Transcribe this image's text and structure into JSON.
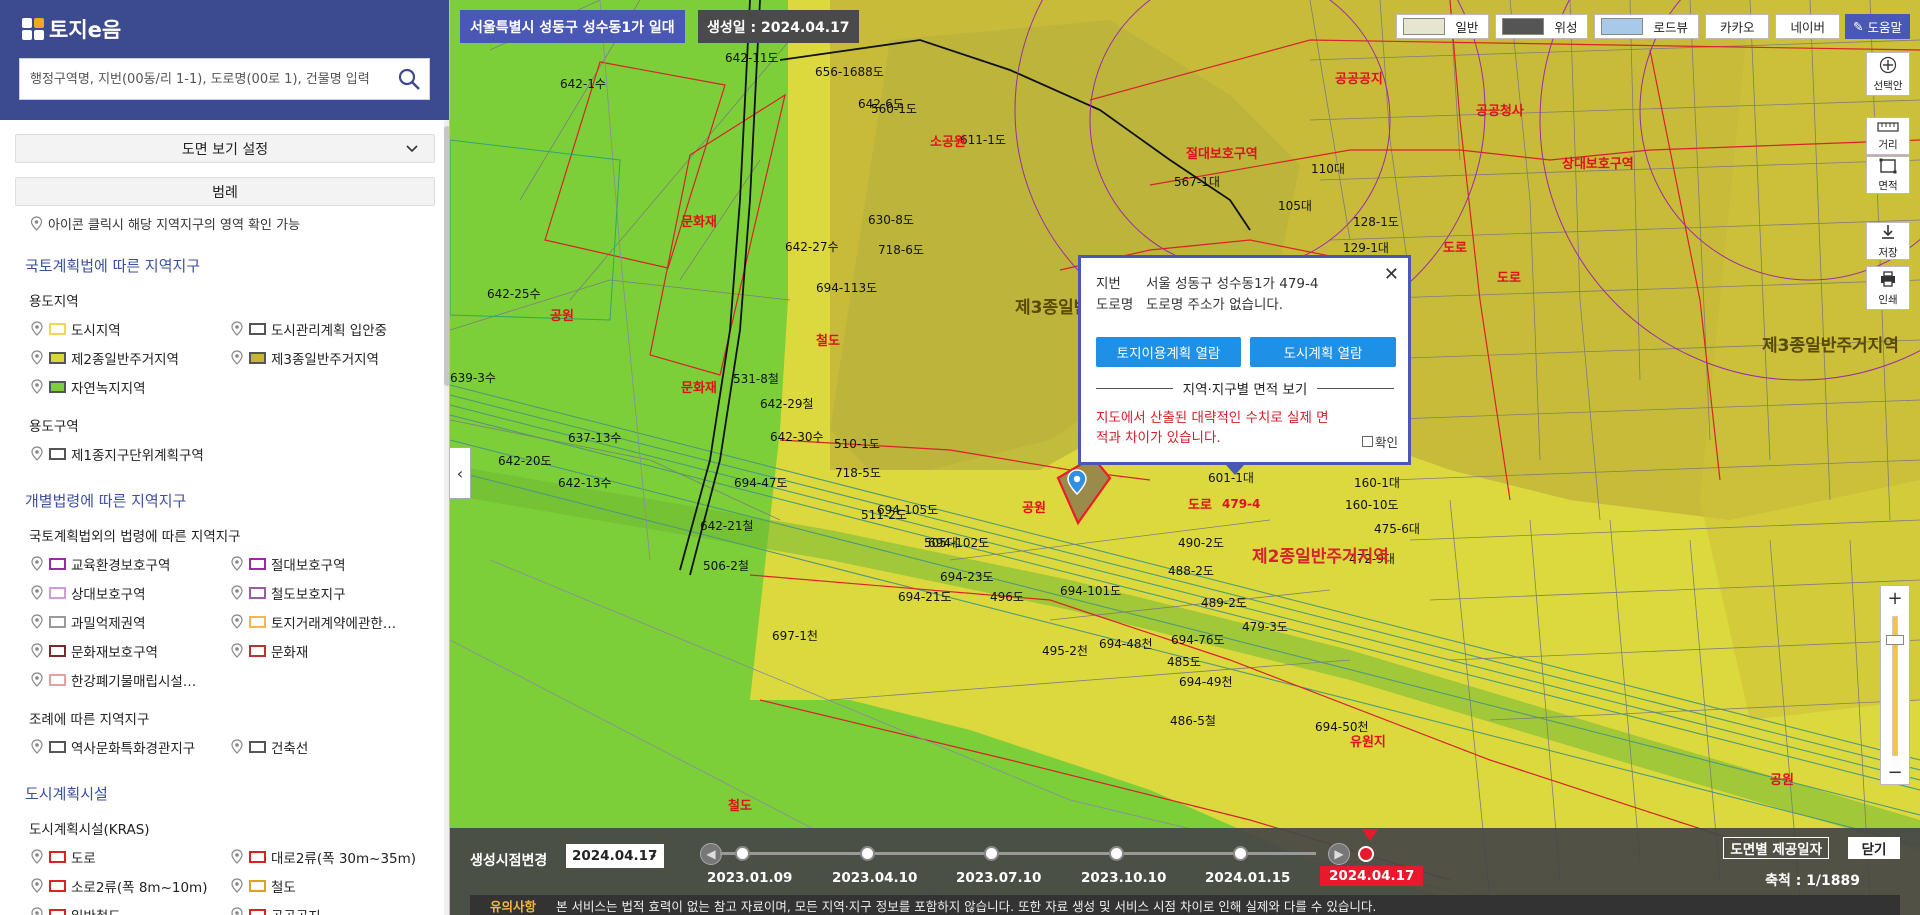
{
  "app": {
    "title": "토지e음"
  },
  "search": {
    "placeholder": "행정구역명, 지번(00동/리 1-1), 도로명(00로 1), 건물명 입력"
  },
  "sidebar": {
    "view_settings": "도면 보기 설정",
    "legend": "범례",
    "hint": "아이콘 클릭시 해당 지역지구의 영역 확인 가능",
    "sections": [
      {
        "title": "국토계획법에 따른 지역지구",
        "groups": [
          {
            "title": "용도지역",
            "items": [
              {
                "label": "도시지역",
                "color": "#f2d64b",
                "fill": "#ffffff"
              },
              {
                "label": "도시관리계획 입안중",
                "color": "#555555",
                "fill": "#ffffff"
              },
              {
                "label": "제2종일반주거지역",
                "color": "#555555",
                "fill": "#d8d83a"
              },
              {
                "label": "제3종일반주거지역",
                "color": "#555555",
                "fill": "#c4b534"
              },
              {
                "label": "자연녹지지역",
                "color": "#555555",
                "fill": "#7bd03a"
              }
            ]
          },
          {
            "title": "용도구역",
            "items": [
              {
                "label": "제1종지구단위계획구역",
                "color": "#555555",
                "fill": "#ffffff"
              }
            ]
          }
        ]
      },
      {
        "title": "개별법령에 따른 지역지구",
        "groups": [
          {
            "title": "국토계획법외의 법령에 따른 지역지구",
            "items": [
              {
                "label": "교육환경보호구역",
                "color": "#9c2aa8",
                "fill": "#ffffff"
              },
              {
                "label": "절대보호구역",
                "color": "#9c2aa8",
                "fill": "#ffffff"
              },
              {
                "label": "상대보호구역",
                "color": "#d39ad7",
                "fill": "#ffffff"
              },
              {
                "label": "철도보호지구",
                "color": "#9c5aa8",
                "fill": "#ffffff"
              },
              {
                "label": "과밀억제권역",
                "color": "#999999",
                "fill": "#ffffff"
              },
              {
                "label": "토지거래계약에관한…",
                "color": "#f2b84b",
                "fill": "#ffffff"
              },
              {
                "label": "문화재보호구역",
                "color": "#7a2a2a",
                "fill": "#ffffff"
              },
              {
                "label": "문화재",
                "color": "#c03030",
                "fill": "#ffffff"
              },
              {
                "label": "한강폐기물매립시설…",
                "color": "#e8a0a0",
                "fill": "#ffffff"
              }
            ]
          },
          {
            "title": "조례에 따른 지역지구",
            "items": [
              {
                "label": "역사문화특화경관지구",
                "color": "#555555",
                "fill": "#ffffff"
              },
              {
                "label": "건축선",
                "color": "#555555",
                "fill": "#ffffff"
              }
            ]
          }
        ]
      },
      {
        "title": "도시계획시설",
        "groups": [
          {
            "title": "도시계획시설(KRAS)",
            "items": [
              {
                "label": "도로",
                "color": "#e02020",
                "fill": "#ffffff"
              },
              {
                "label": "대로2류(폭 30m~35m)",
                "color": "#e02020",
                "fill": "#ffffff"
              },
              {
                "label": "소로2류(폭 8m~10m)",
                "color": "#e02020",
                "fill": "#ffffff"
              },
              {
                "label": "철도",
                "color": "#e0a020",
                "fill": "#ffffff"
              },
              {
                "label": "일반철도",
                "color": "#e02020",
                "fill": "#ffffff"
              },
              {
                "label": "공공공지",
                "color": "#e02020",
                "fill": "#ffffff"
              }
            ]
          }
        ]
      }
    ]
  },
  "map": {
    "address": "서울특별시 성동구 성수동1가 일대",
    "created_date": "생성일 : 2024.04.17",
    "map_types": [
      "일반",
      "위성",
      "로드뷰",
      "카카오",
      "네이버"
    ],
    "help": "도움말",
    "tools": [
      {
        "label": "선택안",
        "icon": "plus-circle-icon"
      },
      {
        "label": "거리",
        "icon": "ruler-icon"
      },
      {
        "label": "면적",
        "icon": "area-icon"
      },
      {
        "label": "저장",
        "icon": "download-icon"
      },
      {
        "label": "인쇄",
        "icon": "print-icon"
      }
    ],
    "labels_black": [
      [
        "642-1수",
        0,
        0
      ],
      [
        "642-11도",
        0,
        0
      ],
      [
        "656-1688도",
        0,
        0
      ],
      [
        "560-1도",
        0,
        0
      ],
      [
        "611-1도",
        0,
        0
      ],
      [
        "642-6도",
        0,
        0
      ],
      [
        "642-27수",
        0,
        0
      ],
      [
        "630-8도",
        0,
        0
      ],
      [
        "718-6도",
        0,
        0
      ],
      [
        "694-113도",
        0,
        0
      ],
      [
        "642-25수",
        0,
        0
      ],
      [
        "639-3수",
        0,
        0
      ],
      [
        "531-8철",
        0,
        0
      ],
      [
        "642-29철",
        0,
        0
      ],
      [
        "637-13수",
        0,
        0
      ],
      [
        "642-30수",
        0,
        0
      ],
      [
        "510-1도",
        0,
        0
      ],
      [
        "642-20도",
        0,
        0
      ],
      [
        "642-13수",
        0,
        0
      ],
      [
        "694-47도",
        0,
        0
      ],
      [
        "718-5도",
        0,
        0
      ],
      [
        "511-2도",
        0,
        0
      ],
      [
        "694-105도",
        0,
        0
      ],
      [
        "642-21철",
        0,
        0
      ],
      [
        "505대",
        0,
        0
      ],
      [
        "694-102도",
        0,
        0
      ],
      [
        "506-2철",
        0,
        0
      ],
      [
        "694-23도",
        0,
        0
      ],
      [
        "694-21도",
        0,
        0
      ],
      [
        "496도",
        0,
        0
      ],
      [
        "694-101도",
        0,
        0
      ],
      [
        "697-1천",
        0,
        0
      ],
      [
        "495-2천",
        0,
        0
      ],
      [
        "694-48천",
        0,
        0
      ],
      [
        "694-76도",
        0,
        0
      ],
      [
        "485도",
        0,
        0
      ],
      [
        "694-49천",
        0,
        0
      ],
      [
        "486-5철",
        0,
        0
      ],
      [
        "694-50천",
        0,
        0
      ],
      [
        "567-1대",
        0,
        0
      ],
      [
        "110대",
        0,
        0
      ],
      [
        "105대",
        0,
        0
      ],
      [
        "128-1도",
        0,
        0
      ],
      [
        "129-1대",
        0,
        0
      ],
      [
        "601-1대",
        0,
        0
      ],
      [
        "490-2도",
        0,
        0
      ],
      [
        "488-2도",
        0,
        0
      ],
      [
        "489-2도",
        0,
        0
      ],
      [
        "479-3도",
        0,
        0
      ],
      [
        "475-6대",
        0,
        0
      ],
      [
        "472-9대",
        0,
        0
      ],
      [
        "160-10도",
        0,
        0
      ],
      [
        "160-1대",
        0,
        0
      ]
    ],
    "labels_red": [
      "소공원",
      "절대보호구역",
      "문화재",
      "공원",
      "철도",
      "문화재",
      "공원",
      "도로",
      "도로",
      "공공공지",
      "공공청사",
      "상대보호구역",
      "도로",
      "유원지",
      "공원",
      "철도"
    ],
    "zone_labels": [
      "제3종일반주거지역",
      "제2종일반주거지역",
      "제3종일반주거지역"
    ],
    "parcel_number": "479-4"
  },
  "popup": {
    "jibun_key": "지번",
    "jibun_value": "서울 성동구 성수동1가 479-4",
    "road_key": "도로명",
    "road_value": "도로명 주소가 없습니다.",
    "btn_land_use": "토지이용계획 열람",
    "btn_city_plan": "도시계획 열람",
    "area_title": "지역·지구별 면적 보기",
    "warning": "지도에서 산출된 대략적인 수치로 실제 면적과 차이가 있습니다.",
    "confirm": "확인"
  },
  "timeline": {
    "label": "생성시점변경",
    "selected": "2024.04.17",
    "dates": [
      "2023.01.09",
      "2023.04.10",
      "2023.07.10",
      "2023.10.10",
      "2024.01.15",
      "2024.04.17"
    ],
    "active_index": 5,
    "provide_btn": "도면별 제공일자",
    "close_btn": "닫기",
    "scale": "축척 : 1/1889"
  },
  "notice": {
    "key": "유의사항",
    "text": "본 서비스는 법적 효력이 없는 참고 자료이며, 모든 지역·지구 정보를 포함하지 않습니다. 또한 자료 생성 및 서비스 시점 차이로 인해 실제와 다를 수 있습니다."
  },
  "colors": {
    "header": "#3c4a8f",
    "accent": "#4a58b5",
    "button_blue": "#1e90e6",
    "green_zone": "#7bd03a",
    "yellow_zone": "#d8d83a",
    "olive_zone": "#c4b534"
  }
}
